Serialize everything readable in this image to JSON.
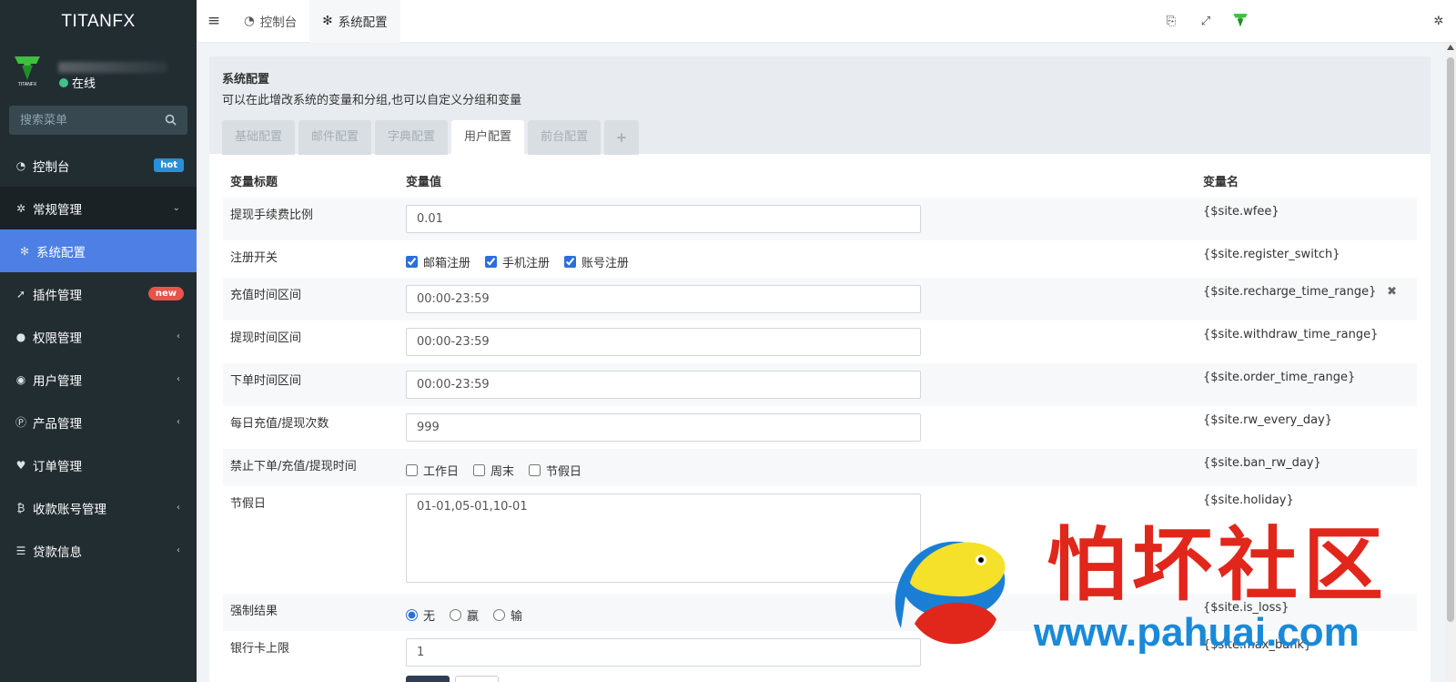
{
  "brand": "TITANFX",
  "user": {
    "status": "在线"
  },
  "sidebar": {
    "search_placeholder": "搜索菜单",
    "items": [
      {
        "label": "控制台",
        "icon": "dashboard-icon",
        "badge": "hot"
      },
      {
        "label": "常规管理",
        "icon": "cogs-icon"
      },
      {
        "label": "系统配置",
        "icon": "gear-icon"
      },
      {
        "label": "插件管理",
        "icon": "rocket-icon",
        "badge": "new"
      },
      {
        "label": "权限管理",
        "icon": "users-icon"
      },
      {
        "label": "用户管理",
        "icon": "user-circle-icon"
      },
      {
        "label": "产品管理",
        "icon": "product-icon"
      },
      {
        "label": "订单管理",
        "icon": "heartbeat-icon"
      },
      {
        "label": "收款账号管理",
        "icon": "bitcoin-icon"
      },
      {
        "label": "贷款信息",
        "icon": "list-icon"
      }
    ]
  },
  "topbar": {
    "tabs": [
      {
        "label": "控制台",
        "icon": "dashboard-icon"
      },
      {
        "label": "系统配置",
        "icon": "gear-icon"
      }
    ]
  },
  "panel": {
    "title": "系统配置",
    "subtitle": "可以在此增改系统的变量和分组,也可以自定义分组和变量",
    "tabs": [
      "基础配置",
      "邮件配置",
      "字典配置",
      "用户配置",
      "前台配置"
    ],
    "active_tab": "用户配置"
  },
  "table": {
    "headers": {
      "title": "变量标题",
      "value": "变量值",
      "name": "变量名"
    },
    "rows": [
      {
        "title": "提现手续费比例",
        "value": "0.01",
        "name": "{$site.wfee}"
      },
      {
        "title": "注册开关",
        "options": [
          "邮箱注册",
          "手机注册",
          "账号注册"
        ],
        "name": "{$site.register_switch}"
      },
      {
        "title": "充值时间区间",
        "value": "00:00-23:59",
        "name": "{$site.recharge_time_range}"
      },
      {
        "title": "提现时间区间",
        "value": "00:00-23:59",
        "name": "{$site.withdraw_time_range}"
      },
      {
        "title": "下单时间区间",
        "value": "00:00-23:59",
        "name": "{$site.order_time_range}"
      },
      {
        "title": "每日充值/提现次数",
        "value": "999",
        "name": "{$site.rw_every_day}"
      },
      {
        "title": "禁止下单/充值/提现时间",
        "options": [
          "工作日",
          "周末",
          "节假日"
        ],
        "name": "{$site.ban_rw_day}"
      },
      {
        "title": "节假日",
        "value": "01-01,05-01,10-01",
        "name": "{$site.holiday}"
      },
      {
        "title": "强制结果",
        "options": [
          "无",
          "赢",
          "输"
        ],
        "name": "{$site.is_loss}"
      },
      {
        "title": "银行卡上限",
        "value": "1",
        "name": "{$site.max_bank}"
      }
    ]
  },
  "watermark": {
    "cn": "怕坏社区",
    "url": "www.pahuai.com"
  },
  "colors": {
    "sidebar_bg": "#222d32",
    "active_blue": "#4d7fe4",
    "badge_hot": "#2b8fd8",
    "badge_new": "#e8534a"
  }
}
